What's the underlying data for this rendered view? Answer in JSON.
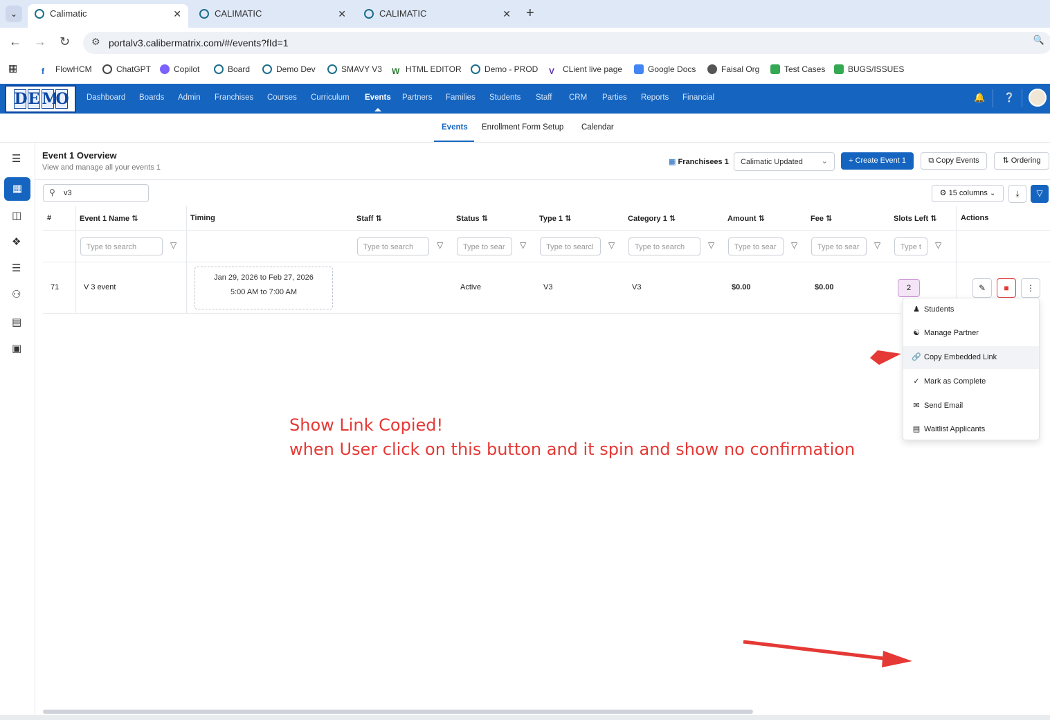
{
  "browser": {
    "tabs": [
      {
        "title": "Calimatic",
        "active": true
      },
      {
        "title": "CALIMATIC",
        "active": false
      },
      {
        "title": "CALIMATIC",
        "active": false
      }
    ],
    "url": "portalv3.calibermatrix.com/#/events?fId=1",
    "bookmarks": [
      "FlowHCM",
      "ChatGPT",
      "Copilot",
      "Board",
      "Demo Dev",
      "SMAVY V3",
      "HTML EDITOR",
      "Demo - PROD",
      "CLient live page",
      "Google Docs",
      "Faisal Org",
      "Test Cases",
      "BUGS/ISSUES"
    ]
  },
  "logo": {
    "letters": [
      "D",
      "E",
      "M",
      "O"
    ]
  },
  "topnav": [
    "Dashboard",
    "Boards",
    "Admin",
    "Franchises",
    "Courses",
    "Curriculum",
    "Events",
    "Partners",
    "Families",
    "Students",
    "Staff",
    "CRM",
    "Parties",
    "Reports",
    "Financial"
  ],
  "subnav": [
    "Events",
    "Enrollment Form Setup",
    "Calendar"
  ],
  "header": {
    "title": "Event 1 Overview",
    "subtitle": "View and manage all your events 1",
    "franchisees_label": "Franchisees 1",
    "franchisee_select": "Calimatic Updated",
    "create_label": "Create Event 1",
    "copy_label": "Copy Events",
    "ordering_label": "Ordering"
  },
  "toolbar": {
    "search_value": "v3",
    "columns_label": "15 columns"
  },
  "table": {
    "headers": [
      "#",
      "Event 1 Name",
      "Timing",
      "Staff",
      "Status",
      "Type 1",
      "Category 1",
      "Amount",
      "Fee",
      "Slots Left",
      "Actions"
    ],
    "filter_placeholders": [
      "Type to search",
      "Type to search",
      "Type to sear",
      "Type to searcl",
      "Type to search",
      "Type to sear",
      "Type to sear",
      "Type t"
    ],
    "row": {
      "id": "71",
      "name": "V 3 event",
      "timing_dates": "Jan 29, 2026 to Feb 27, 2026",
      "timing_hours": "5:00 AM to 7:00 AM",
      "staff": "",
      "status": "Active",
      "type": "V3",
      "category": "V3",
      "amount": "$0.00",
      "fee": "$0.00",
      "slots_left": "2"
    }
  },
  "menu": {
    "items": [
      "Students",
      "Manage Partner",
      "Copy Embedded Link",
      "Mark as Complete",
      "Send Email",
      "Waitlist Applicants"
    ]
  },
  "annotation": {
    "line1": "Show Link Copied!",
    "line2": "when User click on this button and it spin and show no confirmation",
    "color": "#e53935"
  },
  "colors": {
    "brand": "#1565c0",
    "danger": "#e53935"
  }
}
